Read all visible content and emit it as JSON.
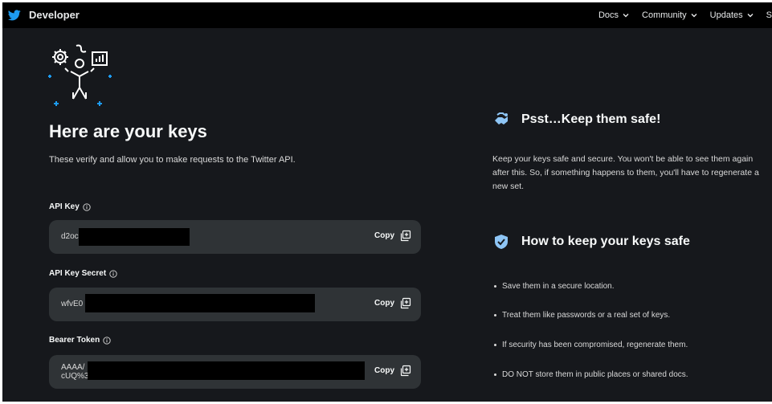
{
  "header": {
    "brand_label": "Developer",
    "nav": [
      "Docs",
      "Community",
      "Updates",
      "S"
    ]
  },
  "main": {
    "title": "Here are your keys",
    "subtitle": "These verify and allow you to make requests to the Twitter API.",
    "keys": [
      {
        "label": "API Key",
        "value_line1": "d2oc",
        "value_line2": "",
        "copy_label": "Copy"
      },
      {
        "label": "API Key Secret",
        "value_line1": "wfvE0",
        "value_line2": "",
        "copy_label": "Copy"
      },
      {
        "label": "Bearer Token",
        "value_line1": "AAAA/",
        "value_line2": "cUQ%3",
        "copy_label": "Copy"
      }
    ]
  },
  "side": {
    "psst_title": "Psst…Keep them safe!",
    "psst_text": "Keep your keys safe and secure. You won't be able to see them again after this. So, if something happens to them, you'll have to regenerate a new set.",
    "how_title": "How to keep your keys safe",
    "tips": [
      "Save them in a secure location.",
      "Treat them like passwords or a real set of keys.",
      "If security has been compromised, regenerate them.",
      "DO NOT store them in public places or shared docs."
    ]
  },
  "colors": {
    "background": "#16181c",
    "topbar": "#000000",
    "key_box": "#2f3336",
    "accent_blue": "#1d9bf0",
    "text": "#e7e9ea"
  },
  "icons": [
    "twitter-bird-icon",
    "chevron-down-icon",
    "developer-illustration",
    "info-icon",
    "copy-icon",
    "handshake-shield-icon",
    "shield-check-icon"
  ]
}
